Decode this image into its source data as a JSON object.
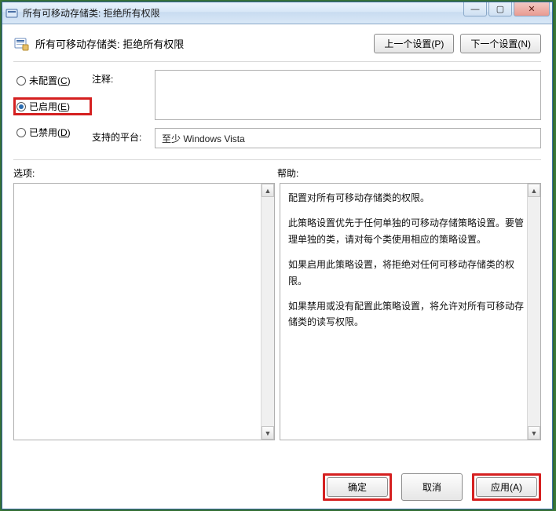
{
  "window": {
    "title": "所有可移动存储类: 拒绝所有权限"
  },
  "header": {
    "title": "所有可移动存储类: 拒绝所有权限",
    "prev_button": "上一个设置(P)",
    "next_button": "下一个设置(N)"
  },
  "radios": {
    "not_configured": {
      "label": "未配置(",
      "key": "C",
      "suffix": ")"
    },
    "enabled": {
      "label": "已启用(",
      "key": "E",
      "suffix": ")"
    },
    "disabled": {
      "label": "已禁用(",
      "key": "D",
      "suffix": ")"
    }
  },
  "fields": {
    "comment_label": "注释:",
    "comment_value": "",
    "platform_label": "支持的平台:",
    "platform_value": "至少 Windows Vista"
  },
  "sections": {
    "options_label": "选项:",
    "help_label": "帮助:"
  },
  "help": {
    "p1": "配置对所有可移动存储类的权限。",
    "p2": "此策略设置优先于任何单独的可移动存储策略设置。要管理单独的类，请对每个类使用相应的策略设置。",
    "p3": "如果启用此策略设置，将拒绝对任何可移动存储类的权限。",
    "p4": "如果禁用或没有配置此策略设置，将允许对所有可移动存储类的读写权限。"
  },
  "footer": {
    "ok": "确定",
    "cancel": "取消",
    "apply": "应用(A)"
  }
}
